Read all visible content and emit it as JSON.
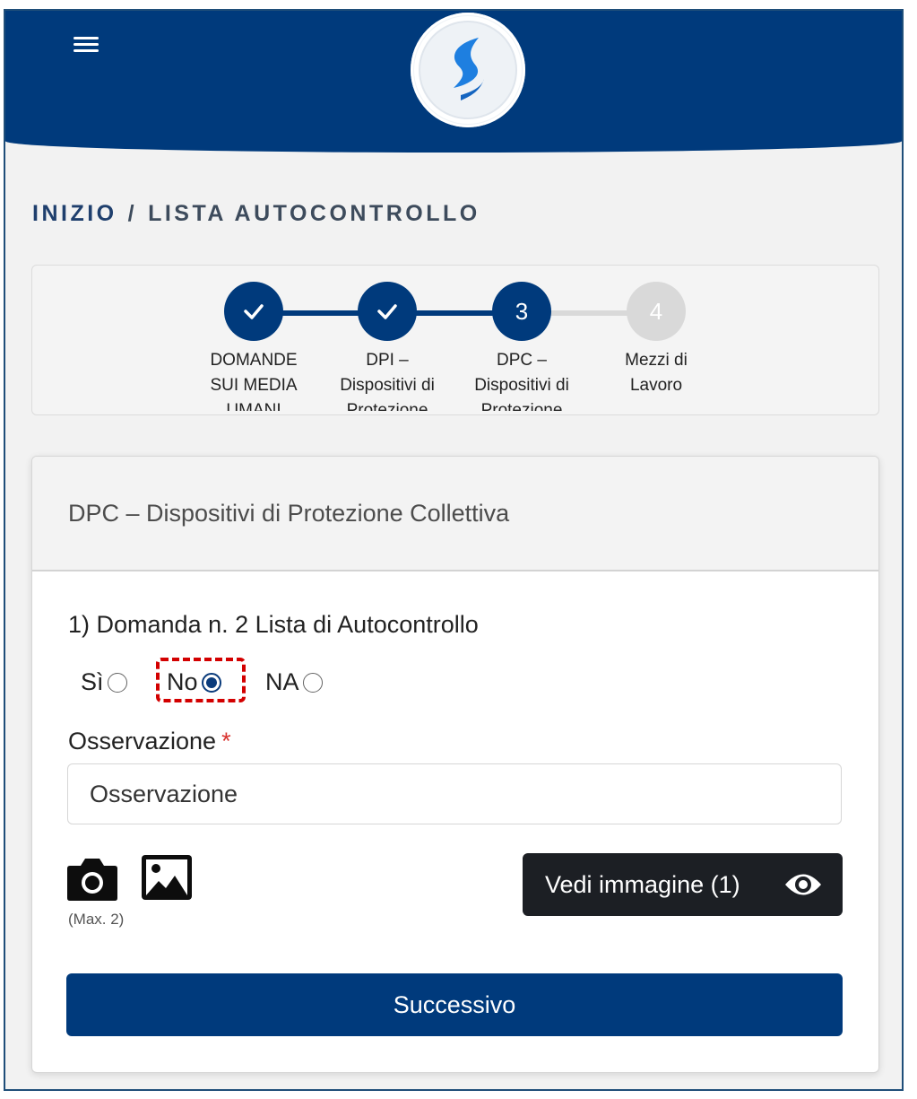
{
  "header": {
    "menu_icon": "hamburger-menu-icon",
    "logo_icon": "app-logo-icon"
  },
  "breadcrumb": {
    "home": "INIZIO",
    "separator": "/",
    "current": "LISTA AUTOCONTROLLO"
  },
  "stepper": {
    "steps": [
      {
        "number": "1",
        "status": "completed",
        "label": "DOMANDE SUI MEDIA UMANI"
      },
      {
        "number": "2",
        "status": "completed",
        "label": "DPI – Dispositivi di Protezione"
      },
      {
        "number": "3",
        "status": "active",
        "label": "DPC – Dispositivi di Protezione"
      },
      {
        "number": "4",
        "status": "pending",
        "label": "Mezzi di Lavoro"
      }
    ]
  },
  "card": {
    "title": "DPC – Dispositivi di Protezione Collettiva",
    "question": "1) Domanda n. 2 Lista di Autocontrollo",
    "options": [
      {
        "label": "Sì",
        "selected": false
      },
      {
        "label": "No",
        "selected": true
      },
      {
        "label": "NA",
        "selected": false
      }
    ],
    "observation_label": "Osservazione",
    "required_mark": "*",
    "observation_placeholder": "Osservazione",
    "max_note": "(Max. 2)",
    "view_image_label": "Vedi immagine (1)",
    "next_label": "Successivo"
  },
  "colors": {
    "primary": "#003a7c",
    "step_pending": "#d9d9d9",
    "highlight": "#d30000",
    "dark_button": "#1c1f24",
    "required": "#d9322e"
  }
}
